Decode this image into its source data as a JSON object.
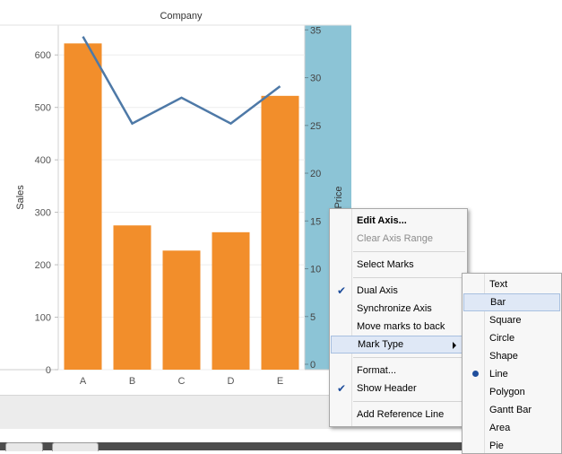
{
  "chart_data": {
    "type": "bar",
    "title": "Company",
    "categories": [
      "A",
      "B",
      "C",
      "D",
      "E"
    ],
    "ylabel": "Sales",
    "ylim": [
      0,
      650
    ],
    "yticks": [
      0,
      100,
      200,
      300,
      400,
      500,
      600
    ],
    "y2label": "Price",
    "y2lim": [
      0,
      35.5
    ],
    "y2ticks": [
      0,
      5,
      10,
      15,
      20,
      25,
      30,
      35
    ],
    "series": [
      {
        "name": "Sales",
        "type": "bar",
        "axis": "left",
        "values": [
          622,
          275,
          227,
          262,
          522
        ]
      },
      {
        "name": "Price",
        "type": "line",
        "axis": "right",
        "values": [
          34.3,
          25.2,
          27.9,
          25.2,
          29.1
        ]
      }
    ],
    "colors": {
      "bar": "#f28e2b",
      "line": "#4e79a7",
      "right_axis_highlight": "#8cc4d6"
    },
    "grid": true
  },
  "context_menu": {
    "items": [
      {
        "label": "Edit Axis...",
        "style": "bold"
      },
      {
        "label": "Clear Axis Range",
        "style": "disabled"
      },
      {
        "separator": true
      },
      {
        "label": "Select Marks"
      },
      {
        "separator": true
      },
      {
        "label": "Dual Axis",
        "checked": true
      },
      {
        "label": "Synchronize Axis"
      },
      {
        "label": "Move marks to back"
      },
      {
        "label": "Mark Type",
        "submenu": true,
        "highlighted": true
      },
      {
        "separator": true
      },
      {
        "label": "Format..."
      },
      {
        "label": "Show Header",
        "checked": true
      },
      {
        "separator": true
      },
      {
        "label": "Add Reference Line"
      }
    ]
  },
  "mark_type_menu": {
    "items": [
      {
        "label": "Text"
      },
      {
        "label": "Bar",
        "highlighted": true
      },
      {
        "label": "Square"
      },
      {
        "label": "Circle"
      },
      {
        "label": "Shape"
      },
      {
        "label": "Line",
        "selected": true
      },
      {
        "label": "Polygon"
      },
      {
        "label": "Gantt Bar"
      },
      {
        "label": "Area"
      },
      {
        "label": "Pie"
      }
    ]
  }
}
